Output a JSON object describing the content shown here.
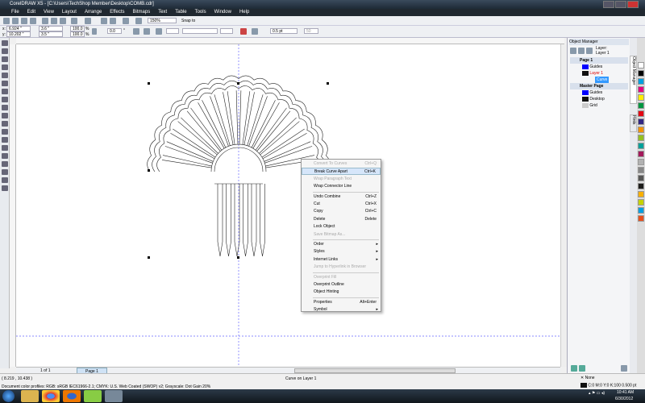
{
  "window": {
    "title": "CorelDRAW X5 - [C:\\Users\\TechShop Member\\Desktop\\COMB.cdr]"
  },
  "menu": [
    "File",
    "Edit",
    "View",
    "Layout",
    "Arrange",
    "Effects",
    "Bitmaps",
    "Text",
    "Table",
    "Tools",
    "Window",
    "Help"
  ],
  "toolbar": {
    "zoom": "150%",
    "snap": "Snap to"
  },
  "propbar": {
    "x": "6.924 \"",
    "y": "10.202 \"",
    "w": "3.6 \"",
    "h": "3.5 \"",
    "sx": "100.0",
    "sy": "100.0",
    "pct": "%",
    "angle": "0.0",
    "deg": "°",
    "outline": "0.5 pt",
    "field": "50"
  },
  "context_menu": [
    {
      "label": "Convert To Curves",
      "shortcut": "Ctrl+Q",
      "disabled": true
    },
    {
      "label": "Break Curve Apart",
      "shortcut": "Ctrl+K",
      "highlight": true
    },
    {
      "label": "Wrap Paragraph Text",
      "shortcut": "",
      "disabled": true
    },
    {
      "label": "Wrap Connector Line",
      "shortcut": ""
    },
    {
      "label": "Undo Combine",
      "shortcut": "Ctrl+Z"
    },
    {
      "label": "Cut",
      "shortcut": "Ctrl+X"
    },
    {
      "label": "Copy",
      "shortcut": "Ctrl+C"
    },
    {
      "label": "Delete",
      "shortcut": "Delete"
    },
    {
      "label": "Lock Object",
      "shortcut": ""
    },
    {
      "label": "Save Bitmap As...",
      "shortcut": "",
      "disabled": true
    },
    {
      "label": "Order",
      "submenu": true
    },
    {
      "label": "Styles",
      "submenu": true
    },
    {
      "label": "Internet Links",
      "submenu": true
    },
    {
      "label": "Jump to Hyperlink in Browser",
      "disabled": true
    },
    {
      "label": "Overprint Fill",
      "disabled": true
    },
    {
      "label": "Overprint Outline"
    },
    {
      "label": "Object Hinting"
    },
    {
      "label": "Properties",
      "shortcut": "Alt+Enter"
    },
    {
      "label": "Symbol",
      "submenu": true
    }
  ],
  "object_manager": {
    "title": "Object Manager",
    "layer_label": "Layer:",
    "layer_value": "Layer 1",
    "tree": {
      "page1": "Page 1",
      "guides": "Guides",
      "layer1": "Layer 1",
      "curve": "Curve",
      "master": "Master Page",
      "mguides": "Guides",
      "desktop": "Desktop",
      "grid": "Grid"
    },
    "tabs": [
      "Object Manager",
      "Hints"
    ]
  },
  "pagenav": {
    "count": "1 of 1",
    "tab": "Page 1"
  },
  "status": {
    "coords": "( 8.219 , 10.438 )",
    "object": "Curve on Layer 1",
    "profiles": "Document color profiles: RGB: sRGB IEC61966-2.1; CMYK: U.S. Web Coated (SWOP) v2; Grayscale: Dot Gain 20%",
    "fill": "None",
    "outline": "C:0 M:0 Y:0 K:100  0.500 pt"
  },
  "taskbar": {
    "time": "10:41 AM",
    "date": "6/30/2012"
  },
  "palette": [
    "#ffffff",
    "#000000",
    "#00a0e0",
    "#e6007e",
    "#ffed00",
    "#009640",
    "#e30613",
    "#312783",
    "#f39200",
    "#95c11f",
    "#00a19a",
    "#a3195b",
    "#b2b2b2",
    "#878787",
    "#575756",
    "#1d1d1b",
    "#f9b000",
    "#c6d300",
    "#009fe3",
    "#e94e1b"
  ]
}
